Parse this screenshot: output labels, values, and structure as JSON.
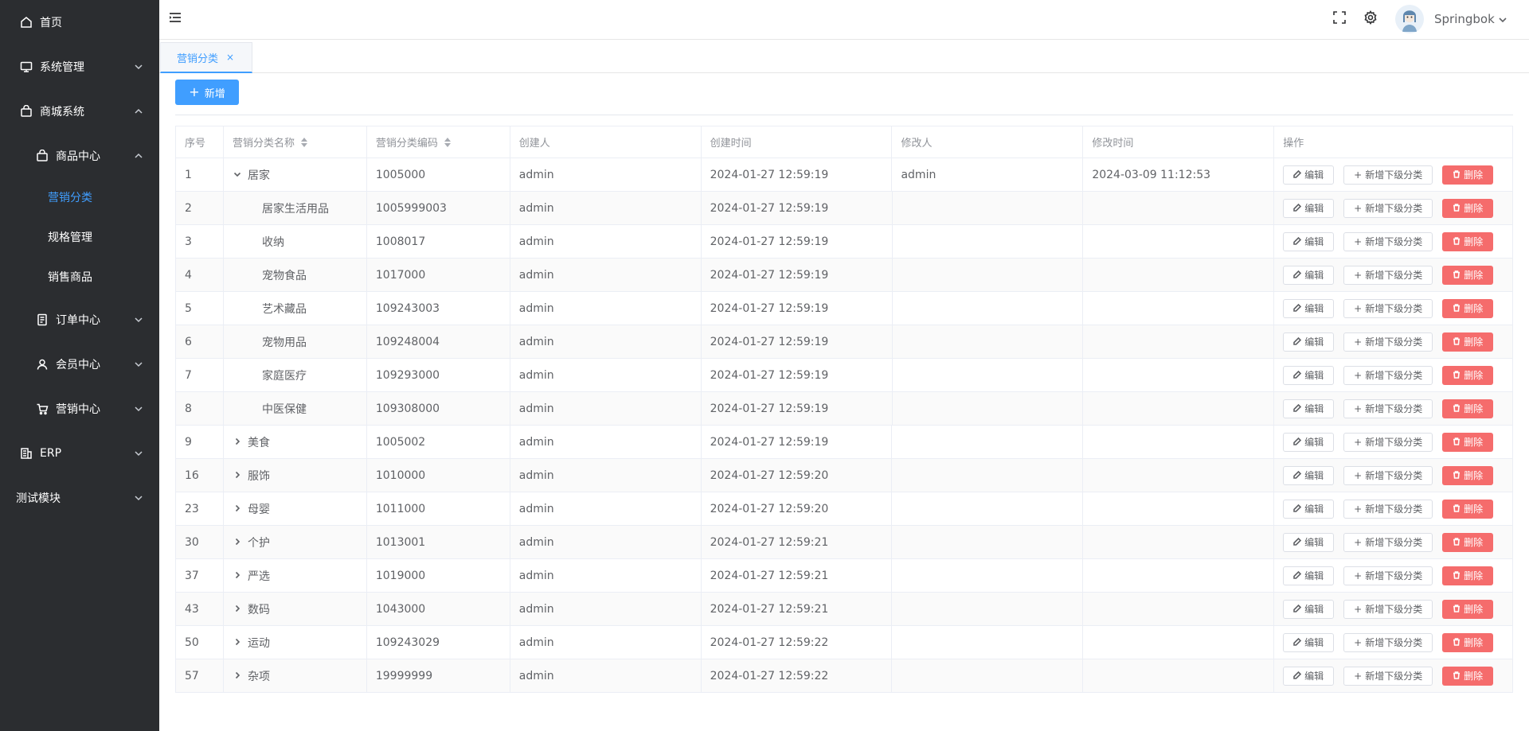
{
  "sidebar": {
    "items": [
      {
        "label": "首页",
        "icon": "home-icon"
      },
      {
        "label": "系统管理",
        "icon": "monitor-icon"
      },
      {
        "label": "商城系统",
        "icon": "shop-bag-icon"
      },
      {
        "label": "商品中心",
        "icon": "shop-bag-icon"
      },
      {
        "label": "营销分类"
      },
      {
        "label": "规格管理"
      },
      {
        "label": "销售商品"
      },
      {
        "label": "订单中心",
        "icon": "document-icon"
      },
      {
        "label": "会员中心",
        "icon": "user-icon"
      },
      {
        "label": "营销中心",
        "icon": "cart-icon"
      },
      {
        "label": "ERP",
        "icon": "building-icon"
      },
      {
        "label": "测试模块"
      }
    ]
  },
  "header": {
    "username": "Springbok"
  },
  "tabs": [
    {
      "label": "营销分类",
      "close": "×"
    }
  ],
  "toolbar": {
    "add_label": "新增",
    "add_plus": "+"
  },
  "table": {
    "columns": [
      "序号",
      "营销分类名称",
      "营销分类编码",
      "创建人",
      "创建时间",
      "修改人",
      "修改时间",
      "操作"
    ],
    "actions": {
      "edit": "编辑",
      "add_sub": "新增下级分类",
      "delete": "删除",
      "plus": "+"
    },
    "rows": [
      {
        "no": "1",
        "name": "居家",
        "code": "1005000",
        "creator": "admin",
        "created": "2024-01-27 12:59:19",
        "modifier": "admin",
        "modified": "2024-03-09 11:12:53",
        "level": "parent-open"
      },
      {
        "no": "2",
        "name": "居家生活用品",
        "code": "1005999003",
        "creator": "admin",
        "created": "2024-01-27 12:59:19",
        "modifier": "",
        "modified": "",
        "level": "child"
      },
      {
        "no": "3",
        "name": "收纳",
        "code": "1008017",
        "creator": "admin",
        "created": "2024-01-27 12:59:19",
        "modifier": "",
        "modified": "",
        "level": "child"
      },
      {
        "no": "4",
        "name": "宠物食品",
        "code": "1017000",
        "creator": "admin",
        "created": "2024-01-27 12:59:19",
        "modifier": "",
        "modified": "",
        "level": "child"
      },
      {
        "no": "5",
        "name": "艺术藏品",
        "code": "109243003",
        "creator": "admin",
        "created": "2024-01-27 12:59:19",
        "modifier": "",
        "modified": "",
        "level": "child"
      },
      {
        "no": "6",
        "name": "宠物用品",
        "code": "109248004",
        "creator": "admin",
        "created": "2024-01-27 12:59:19",
        "modifier": "",
        "modified": "",
        "level": "child"
      },
      {
        "no": "7",
        "name": "家庭医疗",
        "code": "109293000",
        "creator": "admin",
        "created": "2024-01-27 12:59:19",
        "modifier": "",
        "modified": "",
        "level": "child"
      },
      {
        "no": "8",
        "name": "中医保健",
        "code": "109308000",
        "creator": "admin",
        "created": "2024-01-27 12:59:19",
        "modifier": "",
        "modified": "",
        "level": "child"
      },
      {
        "no": "9",
        "name": "美食",
        "code": "1005002",
        "creator": "admin",
        "created": "2024-01-27 12:59:19",
        "modifier": "",
        "modified": "",
        "level": "parent"
      },
      {
        "no": "16",
        "name": "服饰",
        "code": "1010000",
        "creator": "admin",
        "created": "2024-01-27 12:59:20",
        "modifier": "",
        "modified": "",
        "level": "parent"
      },
      {
        "no": "23",
        "name": "母婴",
        "code": "1011000",
        "creator": "admin",
        "created": "2024-01-27 12:59:20",
        "modifier": "",
        "modified": "",
        "level": "parent"
      },
      {
        "no": "30",
        "name": "个护",
        "code": "1013001",
        "creator": "admin",
        "created": "2024-01-27 12:59:21",
        "modifier": "",
        "modified": "",
        "level": "parent"
      },
      {
        "no": "37",
        "name": "严选",
        "code": "1019000",
        "creator": "admin",
        "created": "2024-01-27 12:59:21",
        "modifier": "",
        "modified": "",
        "level": "parent"
      },
      {
        "no": "43",
        "name": "数码",
        "code": "1043000",
        "creator": "admin",
        "created": "2024-01-27 12:59:21",
        "modifier": "",
        "modified": "",
        "level": "parent"
      },
      {
        "no": "50",
        "name": "运动",
        "code": "109243029",
        "creator": "admin",
        "created": "2024-01-27 12:59:22",
        "modifier": "",
        "modified": "",
        "level": "parent"
      },
      {
        "no": "57",
        "name": "杂项",
        "code": "19999999",
        "creator": "admin",
        "created": "2024-01-27 12:59:22",
        "modifier": "",
        "modified": "",
        "level": "parent"
      }
    ]
  },
  "colors": {
    "accent": "#409eff",
    "danger": "#f56c6c",
    "sidebar_bg": "#2b2d30"
  }
}
